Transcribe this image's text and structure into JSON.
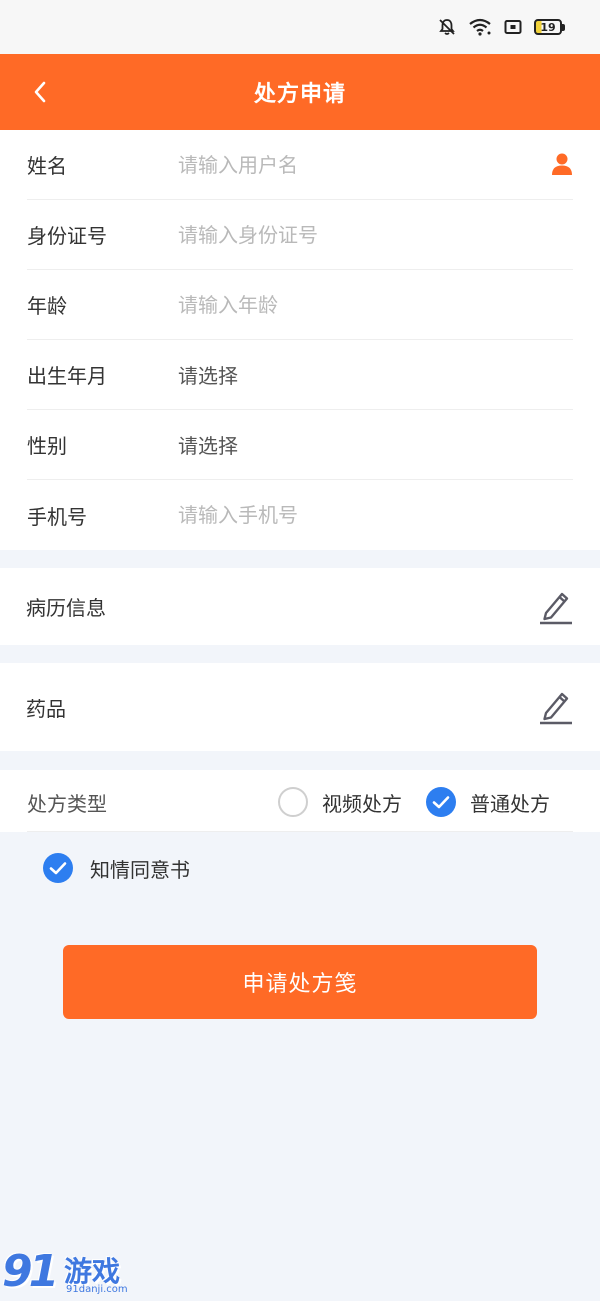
{
  "status_bar": {
    "battery_level": "19",
    "icons": [
      "bell-off-icon",
      "wifi-icon",
      "cast-icon",
      "battery-icon"
    ]
  },
  "header": {
    "title": "处方申请",
    "back_icon": "chevron-left-icon"
  },
  "form": {
    "name": {
      "label": "姓名",
      "placeholder": "请输入用户名",
      "icon": "user-icon"
    },
    "id_number": {
      "label": "身份证号",
      "placeholder": "请输入身份证号"
    },
    "age": {
      "label": "年龄",
      "placeholder": "请输入年龄"
    },
    "birth": {
      "label": "出生年月",
      "value": "请选择"
    },
    "gender": {
      "label": "性别",
      "value": "请选择"
    },
    "phone": {
      "label": "手机号",
      "placeholder": "请输入手机号"
    }
  },
  "medical_record": {
    "label": "病历信息",
    "icon": "edit-icon"
  },
  "medicine": {
    "label": "药品",
    "icon": "edit-icon"
  },
  "prescription_type": {
    "label": "处方类型",
    "options": [
      {
        "label": "视频处方",
        "checked": false
      },
      {
        "label": "普通处方",
        "checked": true
      }
    ]
  },
  "consent": {
    "label": "知情同意书",
    "checked": true
  },
  "submit": {
    "label": "申请处方笺"
  },
  "watermark": {
    "number": "91",
    "name": "游戏",
    "url": "91danji.com"
  },
  "colors": {
    "primary": "#ff6a26",
    "check": "#2d7ef0",
    "background": "#f2f5fa"
  }
}
